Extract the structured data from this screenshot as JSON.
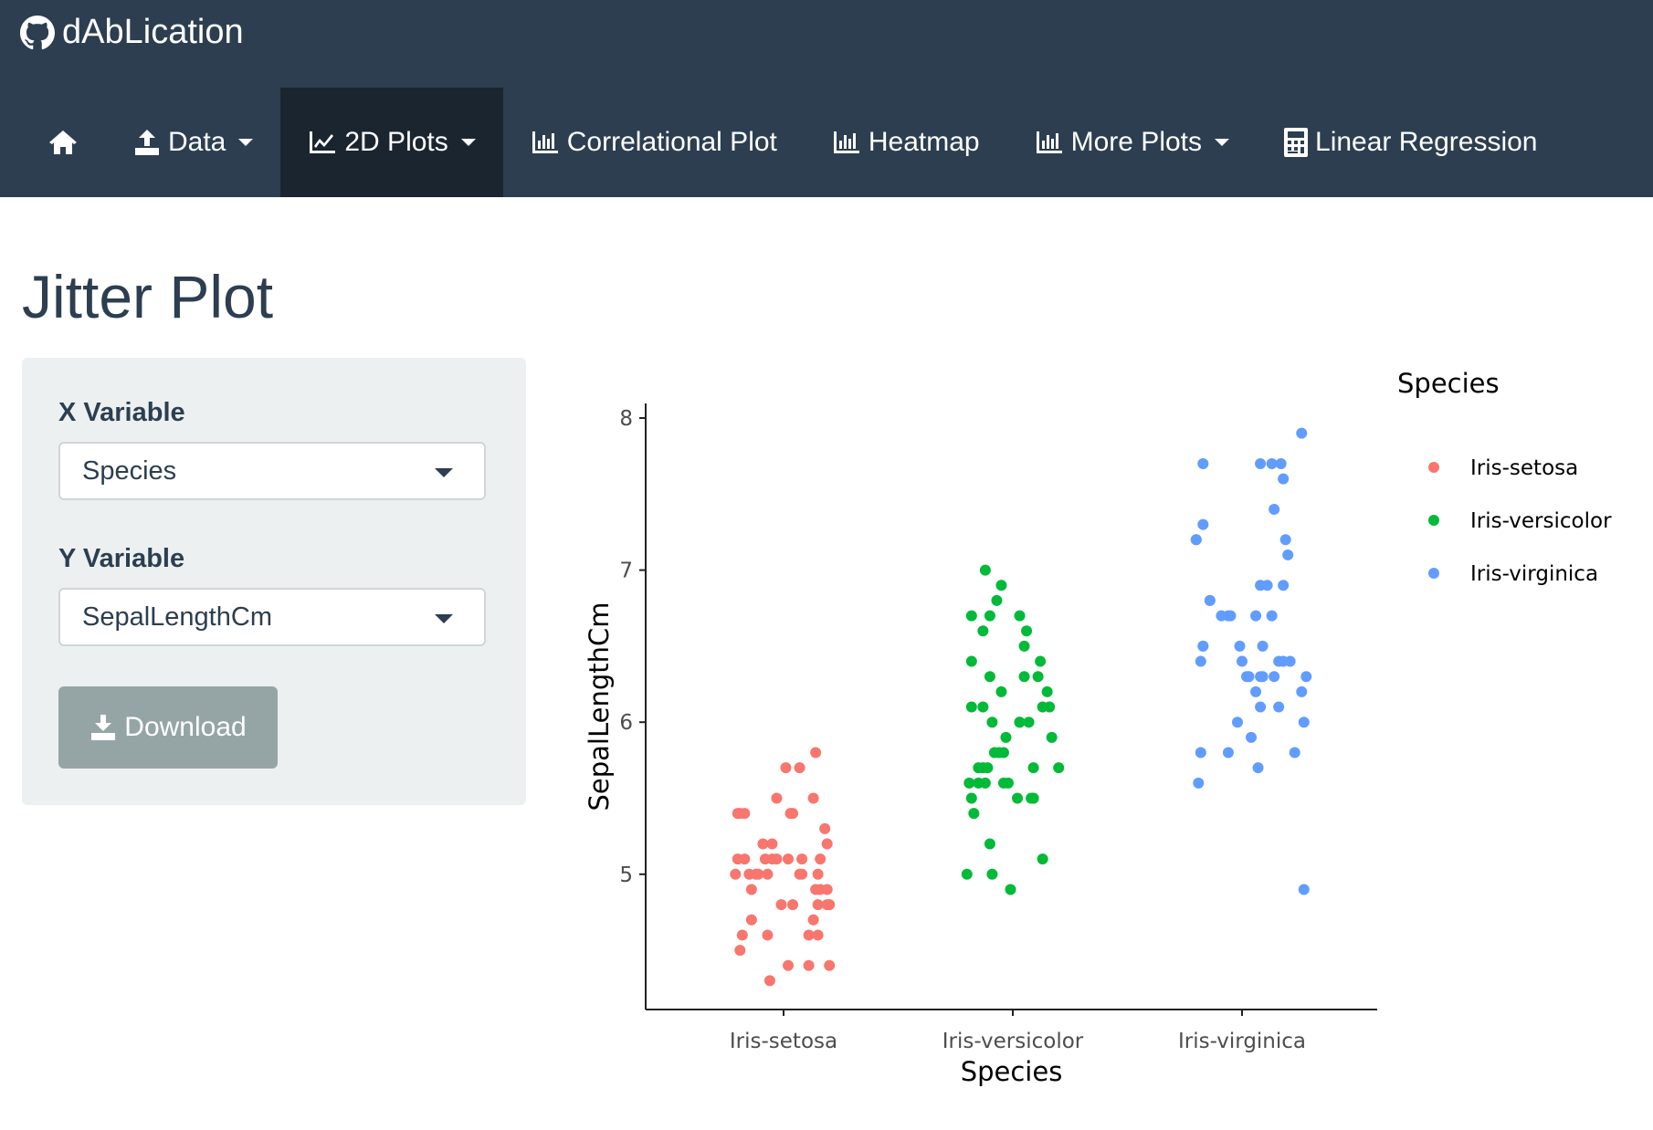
{
  "app": {
    "brand": "dAbLication",
    "brand_icon": "github-icon"
  },
  "nav": {
    "items": [
      {
        "icon": "home-icon",
        "label": "",
        "dropdown": false
      },
      {
        "icon": "upload-icon",
        "label": "Data",
        "dropdown": true
      },
      {
        "icon": "line-chart-icon",
        "label": "2D Plots",
        "dropdown": true,
        "active": true
      },
      {
        "icon": "bar-chart-icon",
        "label": "Correlational Plot",
        "dropdown": false
      },
      {
        "icon": "bar-chart-icon",
        "label": "Heatmap",
        "dropdown": false
      },
      {
        "icon": "bar-chart-icon",
        "label": "More Plots",
        "dropdown": true
      },
      {
        "icon": "calculator-icon",
        "label": "Linear Regression",
        "dropdown": false
      }
    ]
  },
  "page": {
    "title": "Jitter Plot"
  },
  "sidebar": {
    "x_label": "X Variable",
    "x_value": "Species",
    "y_label": "Y Variable",
    "y_value": "SepalLengthCm",
    "download_label": "Download"
  },
  "colors": {
    "navbar": "#2c3e50",
    "nav_active": "#1a252f",
    "panel": "#ecf0f1",
    "button": "#95a5a6"
  },
  "chart_data": {
    "type": "scatter",
    "title": "",
    "xlabel": "Species",
    "ylabel": "SepalLengthCm",
    "categories": [
      "Iris-setosa",
      "Iris-versicolor",
      "Iris-virginica"
    ],
    "yticks": [
      5,
      6,
      7,
      8
    ],
    "ylim": [
      4.2,
      8.1
    ],
    "grid": false,
    "legend": {
      "title": "Species",
      "position": "right"
    },
    "series": [
      {
        "name": "Iris-setosa",
        "color": "#F8766D",
        "points": [
          [
            0.92,
            5.1
          ],
          [
            1.16,
            4.9
          ],
          [
            1.13,
            4.7
          ],
          [
            1.15,
            4.6
          ],
          [
            0.79,
            5.0
          ],
          [
            0.83,
            5.4
          ],
          [
            0.93,
            4.6
          ],
          [
            1.08,
            5.0
          ],
          [
            1.02,
            4.4
          ],
          [
            0.86,
            4.9
          ],
          [
            0.8,
            5.4
          ],
          [
            1.2,
            4.8
          ],
          [
            0.99,
            4.8
          ],
          [
            0.94,
            4.3
          ],
          [
            1.14,
            5.8
          ],
          [
            1.01,
            5.7
          ],
          [
            0.81,
            5.4
          ],
          [
            0.83,
            5.1
          ],
          [
            1.07,
            5.7
          ],
          [
            0.95,
            5.1
          ],
          [
            1.03,
            5.4
          ],
          [
            1.02,
            5.1
          ],
          [
            1.11,
            4.6
          ],
          [
            0.97,
            5.1
          ],
          [
            1.19,
            4.8
          ],
          [
            0.88,
            5.0
          ],
          [
            0.89,
            5.0
          ],
          [
            0.95,
            5.2
          ],
          [
            1.19,
            5.2
          ],
          [
            0.86,
            4.7
          ],
          [
            1.15,
            4.8
          ],
          [
            1.04,
            5.4
          ],
          [
            0.91,
            5.2
          ],
          [
            1.13,
            5.5
          ],
          [
            1.19,
            4.9
          ],
          [
            0.85,
            5.0
          ],
          [
            0.97,
            5.5
          ],
          [
            1.14,
            4.9
          ],
          [
            1.2,
            4.4
          ],
          [
            0.8,
            5.1
          ],
          [
            0.93,
            5.0
          ],
          [
            0.81,
            4.5
          ],
          [
            1.11,
            4.4
          ],
          [
            1.07,
            5.0
          ],
          [
            1.16,
            5.1
          ],
          [
            1.04,
            4.8
          ],
          [
            1.08,
            5.1
          ],
          [
            0.82,
            4.6
          ],
          [
            1.18,
            5.3
          ],
          [
            1.15,
            5.0
          ]
        ]
      },
      {
        "name": "Iris-versicolor",
        "color": "#00BA38",
        "points": [
          [
            1.88,
            7.0
          ],
          [
            1.82,
            6.4
          ],
          [
            1.95,
            6.9
          ],
          [
            1.82,
            5.5
          ],
          [
            2.05,
            6.5
          ],
          [
            1.87,
            5.7
          ],
          [
            1.9,
            6.3
          ],
          [
            1.99,
            4.9
          ],
          [
            2.06,
            6.6
          ],
          [
            1.9,
            5.2
          ],
          [
            1.8,
            5.0
          ],
          [
            1.97,
            5.9
          ],
          [
            2.07,
            6.0
          ],
          [
            2.16,
            6.1
          ],
          [
            1.81,
            5.6
          ],
          [
            2.03,
            6.7
          ],
          [
            1.98,
            5.6
          ],
          [
            1.96,
            5.8
          ],
          [
            1.95,
            6.2
          ],
          [
            1.85,
            5.6
          ],
          [
            2.17,
            5.9
          ],
          [
            1.82,
            6.1
          ],
          [
            2.05,
            6.3
          ],
          [
            1.87,
            6.1
          ],
          [
            2.12,
            6.4
          ],
          [
            1.87,
            6.6
          ],
          [
            1.93,
            6.8
          ],
          [
            1.9,
            6.7
          ],
          [
            2.03,
            6.0
          ],
          [
            1.85,
            5.7
          ],
          [
            2.09,
            5.5
          ],
          [
            2.02,
            5.5
          ],
          [
            1.94,
            5.8
          ],
          [
            1.91,
            6.0
          ],
          [
            1.83,
            5.4
          ],
          [
            2.03,
            6.0
          ],
          [
            1.82,
            6.7
          ],
          [
            2.11,
            6.3
          ],
          [
            1.96,
            5.6
          ],
          [
            2.08,
            5.5
          ],
          [
            2.09,
            5.5
          ],
          [
            2.13,
            6.1
          ],
          [
            1.92,
            5.8
          ],
          [
            1.91,
            5.0
          ],
          [
            1.88,
            5.6
          ],
          [
            2.09,
            5.7
          ],
          [
            1.89,
            5.7
          ],
          [
            2.15,
            6.2
          ],
          [
            2.13,
            5.1
          ],
          [
            2.2,
            5.7
          ]
        ]
      },
      {
        "name": "Iris-virginica",
        "color": "#619CFF",
        "points": [
          [
            3.08,
            6.3
          ],
          [
            2.82,
            5.8
          ],
          [
            3.2,
            7.1
          ],
          [
            3.02,
            6.3
          ],
          [
            2.99,
            6.5
          ],
          [
            3.18,
            7.6
          ],
          [
            3.27,
            4.9
          ],
          [
            2.83,
            7.3
          ],
          [
            2.94,
            6.7
          ],
          [
            2.8,
            7.2
          ],
          [
            3.09,
            6.5
          ],
          [
            3.16,
            6.4
          ],
          [
            2.86,
            6.8
          ],
          [
            3.07,
            5.7
          ],
          [
            2.94,
            5.8
          ],
          [
            3.0,
            6.4
          ],
          [
            2.83,
            6.5
          ],
          [
            3.17,
            7.7
          ],
          [
            3.13,
            7.7
          ],
          [
            2.98,
            6.0
          ],
          [
            3.08,
            6.9
          ],
          [
            2.81,
            5.6
          ],
          [
            3.08,
            7.7
          ],
          [
            3.03,
            6.3
          ],
          [
            2.91,
            6.7
          ],
          [
            3.19,
            7.2
          ],
          [
            3.06,
            6.2
          ],
          [
            3.16,
            6.1
          ],
          [
            2.82,
            6.4
          ],
          [
            2.8,
            7.2
          ],
          [
            3.14,
            7.4
          ],
          [
            3.26,
            7.9
          ],
          [
            3.21,
            6.4
          ],
          [
            3.09,
            6.3
          ],
          [
            3.08,
            6.1
          ],
          [
            2.83,
            7.7
          ],
          [
            3.28,
            6.3
          ],
          [
            3.18,
            6.4
          ],
          [
            3.27,
            6.0
          ],
          [
            3.11,
            6.9
          ],
          [
            3.06,
            6.7
          ],
          [
            3.18,
            6.9
          ],
          [
            3.23,
            5.8
          ],
          [
            2.86,
            6.8
          ],
          [
            2.95,
            6.7
          ],
          [
            3.13,
            6.7
          ],
          [
            3.14,
            6.3
          ],
          [
            2.83,
            6.5
          ],
          [
            3.26,
            6.2
          ],
          [
            3.04,
            5.9
          ]
        ]
      }
    ]
  }
}
